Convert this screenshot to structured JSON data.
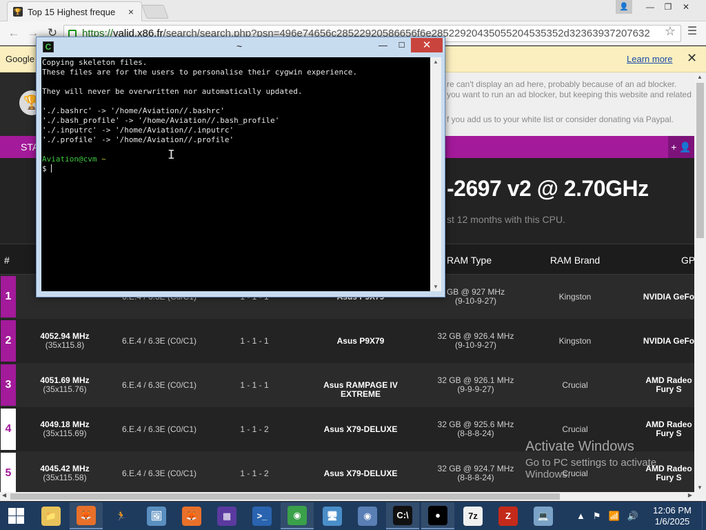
{
  "browser": {
    "tab_title": "Top 15 Highest freque",
    "tab_close": "×",
    "url_prefix": "https://",
    "url_host": "valid.x86.fr",
    "url_rest": "/search/search.php?psn=496e74656c28522920586656f6e28522920435055204535352d32363937207632",
    "infobar_text": "Google",
    "infobar_learn_more": "Learn more",
    "infobar_close": "✕",
    "window_controls": [
      "—",
      "❐",
      "✕"
    ],
    "user_icon": "👤"
  },
  "page": {
    "adblock_lines": [
      "re can't display an ad here, probably because of an ad blocker.",
      "you want to run an ad blocker, but keeping this website and related",
      "f you add us to your white list or consider donating via Paypal."
    ],
    "stats_label": "STA",
    "add_user_label": "+ 👤",
    "cpu_title": "-2697 v2 @ 2.70GHz",
    "cpu_subtitle": "st 12 months with this CPU.",
    "table_headers": {
      "rank": "#",
      "ram_type": "RAM Type",
      "ram_brand": "RAM Brand",
      "gpu": "GP"
    },
    "rows": [
      {
        "rank": "1",
        "freq": "",
        "mult": "(35x115.87)",
        "spec": "6.E.4 / 6.3E (C0/C1)",
        "cores": "1 - 1 - 1",
        "mobo": "Asus P9X79",
        "ram1": "GB @ 927 MHz",
        "ram2": "(9-10-9-27)",
        "brand": "Kingston",
        "gpu1": "NVIDIA GeFo",
        "gpu2": ""
      },
      {
        "rank": "2",
        "freq": "4052.94 MHz",
        "mult": "(35x115.8)",
        "spec": "6.E.4 / 6.3E (C0/C1)",
        "cores": "1 - 1 - 1",
        "mobo": "Asus P9X79",
        "ram1": "32 GB @ 926.4 MHz",
        "ram2": "(9-10-9-27)",
        "brand": "Kingston",
        "gpu1": "NVIDIA GeFo",
        "gpu2": ""
      },
      {
        "rank": "3",
        "freq": "4051.69 MHz",
        "mult": "(35x115.76)",
        "spec": "6.E.4 / 6.3E (C0/C1)",
        "cores": "1 - 1 - 1",
        "mobo": "Asus RAMPAGE IV EXTREME",
        "ram1": "32 GB @ 926.1 MHz",
        "ram2": "(9-9-9-27)",
        "brand": "Crucial",
        "gpu1": "AMD Radeo",
        "gpu2": "Fury S"
      },
      {
        "rank": "4",
        "freq": "4049.18 MHz",
        "mult": "(35x115.69)",
        "spec": "6.E.4 / 6.3E (C0/C1)",
        "cores": "1 - 1 - 2",
        "mobo": "Asus X79-DELUXE",
        "ram1": "32 GB @ 925.6 MHz",
        "ram2": "(8-8-8-24)",
        "brand": "Crucial",
        "gpu1": "AMD Radeo",
        "gpu2": "Fury S"
      },
      {
        "rank": "5",
        "freq": "4045.42 MHz",
        "mult": "(35x115.58)",
        "spec": "6.E.4 / 6.3E (C0/C1)",
        "cores": "1 - 1 - 2",
        "mobo": "Asus X79-DELUXE",
        "ram1": "32 GB @ 924.7 MHz",
        "ram2": "(8-8-8-24)",
        "brand": "Crucial",
        "gpu1": "AMD Radeo",
        "gpu2": "Fury S"
      }
    ],
    "watermark_title": "Activate Windows",
    "watermark_sub1": "Go to PC settings to activate",
    "watermark_sub2": "Windows."
  },
  "terminal": {
    "title": "~",
    "icon_label": "C",
    "min": "—",
    "max": "☐",
    "close": "✕",
    "lines": [
      "Copying skeleton files.",
      "These files are for the users to personalise their cygwin experience.",
      "",
      "They will never be overwritten nor automatically updated.",
      "",
      "'./.bashrc' -> '/home/Aviation//.bashrc'",
      "'./.bash_profile' -> '/home/Aviation//.bash_profile'",
      "'./.inputrc' -> '/home/Aviation//.inputrc'",
      "'./.profile' -> '/home/Aviation//.profile'",
      ""
    ],
    "prompt_user": "Aviation@cvm",
    "prompt_path": "~",
    "prompt_symbol": "$ "
  },
  "taskbar": {
    "items": [
      {
        "name": "file-explorer",
        "label": "📁",
        "color": "#e8c25a"
      },
      {
        "name": "firefox",
        "label": "🦊",
        "color": "#e8702a"
      },
      {
        "name": "runner-app",
        "label": "🏃",
        "color": "#1e3b5e"
      },
      {
        "name": "image-viewer",
        "label": "🖼",
        "color": "#5a8fc0"
      },
      {
        "name": "firefox-2",
        "label": "🦊",
        "color": "#e8702a"
      },
      {
        "name": "cpu-z",
        "label": "▦",
        "color": "#5b3aa0"
      },
      {
        "name": "powershell",
        "label": ">_",
        "color": "#2a64b0"
      },
      {
        "name": "chrome",
        "label": "◉",
        "color": "#3aa04a"
      },
      {
        "name": "remote-desktop",
        "label": "🖥",
        "color": "#4a8ec8"
      },
      {
        "name": "chrome-canary",
        "label": "◉",
        "color": "#5a7fb5"
      },
      {
        "name": "cygwin-terminal",
        "label": "C:\\",
        "color": "#111111"
      },
      {
        "name": "recorder",
        "label": "●",
        "color": "#000000"
      },
      {
        "name": "7zip",
        "label": "7z",
        "color": "#f0f0f0"
      },
      {
        "name": "filezilla",
        "label": "Z",
        "color": "#c42a1a"
      },
      {
        "name": "network-computer",
        "label": "💻",
        "color": "#7ba3c8"
      }
    ],
    "tray_icons": [
      "▲",
      "⚑",
      "📶",
      "🔊"
    ],
    "time": "12:06 PM",
    "date": "1/6/2025"
  }
}
